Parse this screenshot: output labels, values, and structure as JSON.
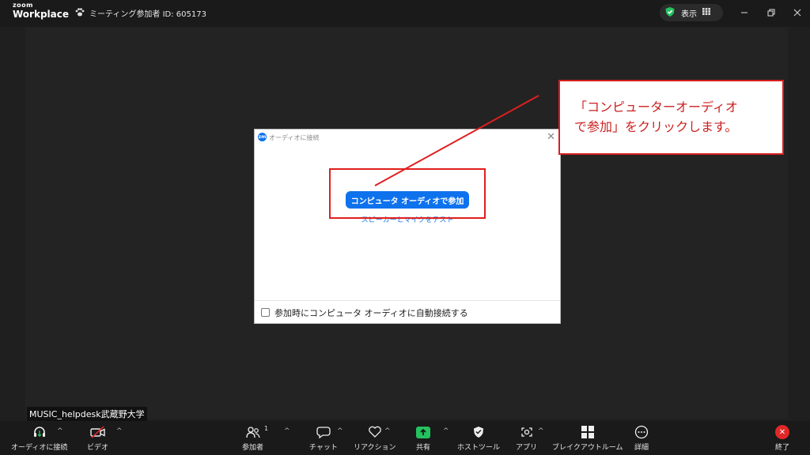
{
  "titlebar": {
    "brand_top": "zoom",
    "brand_bottom": "Workplace",
    "meeting_info": "ミーティング参加者 ID: 605173",
    "view_label": "表示"
  },
  "participant": {
    "name": "MUSIC_helpdesk武蔵野大学"
  },
  "dialog": {
    "badge": "zm",
    "title": "オーディオに接続",
    "join_button": "コンピュータ オーディオで参加",
    "test_link": "スピーカーとマイクをテスト",
    "auto_connect_label": "参加時にコンピュータ オーディオに自動接続する"
  },
  "annotation": {
    "line1": "「コンピューターオーディオ",
    "line2": "で参加」をクリックします。"
  },
  "toolbar": {
    "audio": "オーディオに接続",
    "video": "ビデオ",
    "participants": "参加者",
    "participants_count": "1",
    "chat": "チャット",
    "reactions": "リアクション",
    "share": "共有",
    "host_tools": "ホストツール",
    "apps": "アプリ",
    "breakout": "ブレイクアウトルーム",
    "more": "詳細",
    "end": "終了"
  },
  "colors": {
    "accent_blue": "#0e72ed",
    "annotation_red": "#d71f1f",
    "share_green": "#24c15e",
    "end_red": "#e02828"
  },
  "icons": [
    "zoom-logo",
    "paw-icon",
    "shield-check-icon",
    "grid-icon",
    "minimize-icon",
    "restore-icon",
    "close-icon",
    "headphone-icon",
    "video-off-icon",
    "people-icon",
    "chat-icon",
    "heart-icon",
    "share-arrow-icon",
    "shield-icon",
    "apps-icon",
    "breakout-icon",
    "more-icon",
    "end-icon"
  ]
}
